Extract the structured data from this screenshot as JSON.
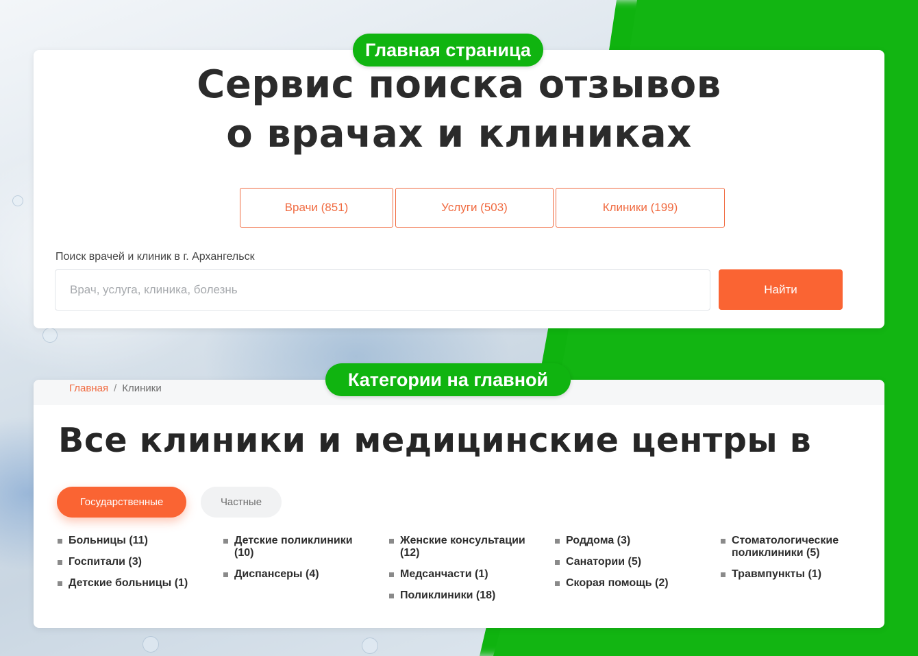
{
  "labels": {
    "main_page": "Главная страница",
    "categories_on_main": "Категории на главной"
  },
  "hero": {
    "title_line1": "Сервис поиска отзывов",
    "title_line2": "о врачах и клиниках",
    "tabs": [
      {
        "label": "Врачи (851)"
      },
      {
        "label": "Услуги (503)"
      },
      {
        "label": "Клиники (199)"
      }
    ],
    "search": {
      "label": "Поиск врачей и клиник в г. Архангельск",
      "placeholder": "Врач, услуга, клиника, болезнь",
      "value": "",
      "button": "Найти"
    }
  },
  "catalog": {
    "breadcrumbs": {
      "home": "Главная",
      "separator": "/",
      "current": "Клиники"
    },
    "title": "Все клиники и медицинские центры в",
    "filters": {
      "active": "Государственные",
      "inactive": "Частные"
    },
    "columns": [
      [
        "Больницы (11)",
        "Госпитали (3)",
        "Детские больницы (1)"
      ],
      [
        "Детские поликлиники (10)",
        "Диспансеры (4)"
      ],
      [
        "Женские консультации (12)",
        "Медсанчасти (1)",
        "Поликлиники (18)"
      ],
      [
        "Роддома (3)",
        "Санатории (5)",
        "Скорая помощь (2)"
      ],
      [
        "Стоматологические поликлиники (5)",
        "Травмпункты (1)"
      ]
    ]
  },
  "colors": {
    "accent": "#fa6433",
    "green": "#10b410",
    "text": "#2b2b2b"
  }
}
